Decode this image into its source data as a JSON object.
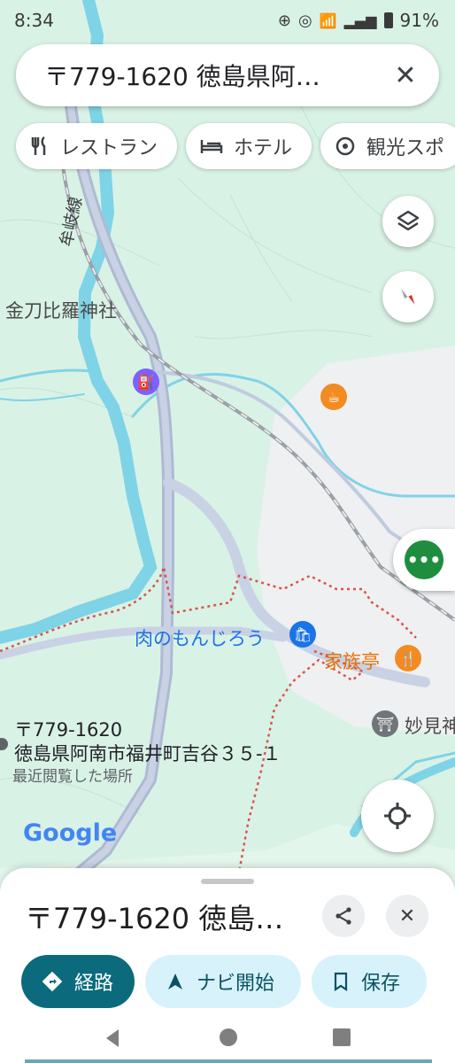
{
  "status_bar": {
    "time": "8:34",
    "battery": "91%"
  },
  "search": {
    "text": "〒779-1620 徳島県阿…"
  },
  "chips": [
    {
      "label": "レストラン",
      "icon": "fork-knife-icon"
    },
    {
      "label": "ホテル",
      "icon": "bed-icon"
    },
    {
      "label": "観光スポ",
      "icon": "camera-icon"
    }
  ],
  "map": {
    "labels": {
      "rail_line": "牟岐線",
      "shrine": "金刀比羅神社",
      "shop": "肉のもんじろう",
      "restaurant": "家族亭",
      "temple": "妙見神",
      "pin_postal": "〒779-1620",
      "pin_address": "徳島県阿南市福井町吉谷３５-１",
      "pin_note": "最近閲覧した場所",
      "google_logo": "Google"
    },
    "colors": {
      "land": "#d9f2e6",
      "water": "#7fd3e6",
      "road": "#aebad3",
      "urban": "#f1f3f4",
      "boundary": "#d9544b"
    }
  },
  "sheet": {
    "title": "〒779-1620 徳島…",
    "actions": [
      {
        "label": "経路",
        "icon": "directions-icon"
      },
      {
        "label": "ナビ開始",
        "icon": "navigation-arrow-icon"
      },
      {
        "label": "保存",
        "icon": "bookmark-icon"
      }
    ]
  }
}
